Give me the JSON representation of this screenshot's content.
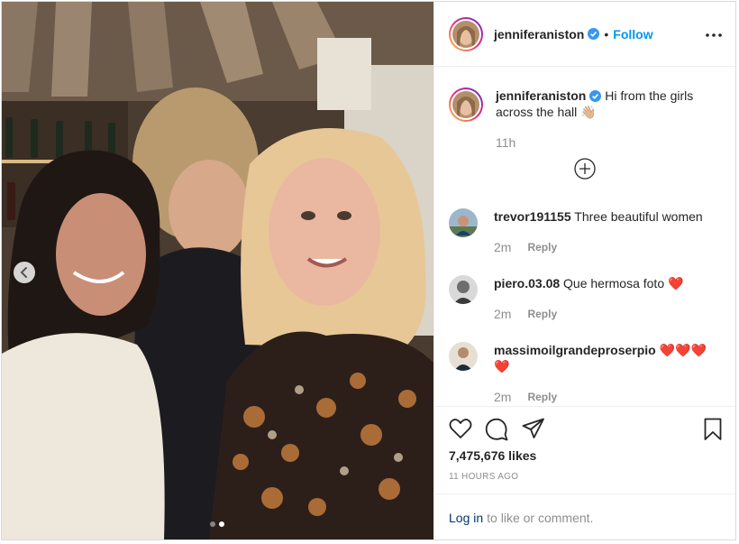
{
  "post": {
    "author": "jenniferaniston",
    "follow_label": "Follow",
    "separator": "•",
    "caption_text": "Hi from the girls across the hall",
    "caption_emoji": "👋🏼",
    "caption_time": "11h"
  },
  "comments": [
    {
      "user": "trevor191155",
      "text": "Three beautiful women",
      "time": "2m",
      "reply_label": "Reply"
    },
    {
      "user": "piero.03.08",
      "text": "Que hermosa foto",
      "emoji": "❤️",
      "time": "2m",
      "reply_label": "Reply"
    },
    {
      "user": "massimoilgrandeproserpio",
      "emoji": "❤️❤️❤️ ❤️",
      "time": "2m",
      "reply_label": "Reply"
    }
  ],
  "engagement": {
    "likes": "7,475,676 likes",
    "posted": "11 HOURS AGO"
  },
  "login": {
    "link": "Log in",
    "rest": "to like or comment."
  },
  "carousel": {
    "slides": 2,
    "active": 2
  },
  "colors": {
    "accent": "#0095f6",
    "verified": "#3897f0",
    "heart": "#ed1c24",
    "muted": "#8e8e8e"
  },
  "icons": [
    "chevron-left-icon",
    "more-options-icon",
    "verified-icon",
    "plus-circle-icon",
    "heart-icon",
    "comment-icon",
    "share-icon",
    "bookmark-icon"
  ]
}
